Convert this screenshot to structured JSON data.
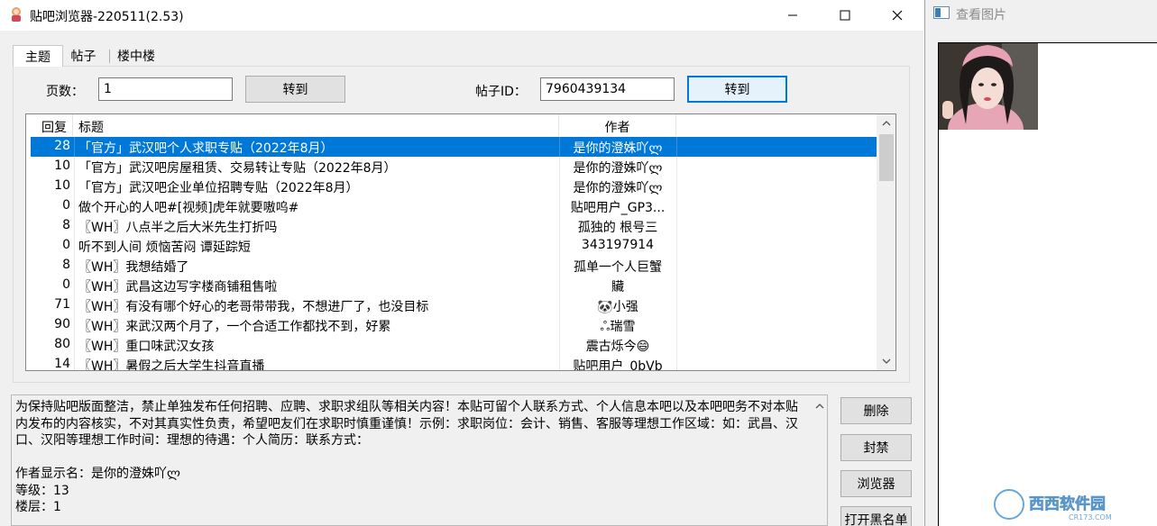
{
  "window": {
    "title": "贴吧浏览器-220511(2.53)"
  },
  "tabs": [
    {
      "label": "主题"
    },
    {
      "label": "帖子"
    },
    {
      "label": "楼中楼"
    }
  ],
  "page_label": "页数：",
  "page_value": "1",
  "goto_page_label": "转到",
  "post_id_label": "帖子ID：",
  "post_id_value": "7960439134",
  "goto_post_label": "转到",
  "list": {
    "headers": {
      "replies": "回复",
      "title": "标题",
      "author": "作者"
    },
    "rows": [
      {
        "replies": "28",
        "title": "「官方」武汉吧个人求职专贴（2022年8月）",
        "author": "是你的澄姝吖ლ",
        "selected": true
      },
      {
        "replies": "10",
        "title": "「官方」武汉吧房屋租赁、交易转让专贴（2022年8月）",
        "author": "是你的澄姝吖ლ"
      },
      {
        "replies": "10",
        "title": "「官方」武汉吧企业单位招聘专贴（2022年8月）",
        "author": "是你的澄姝吖ლ"
      },
      {
        "replies": "0",
        "title": "做个开心的人吧#[视频]虎年就要嗷呜#",
        "author": "贴吧用户_GP3..."
      },
      {
        "replies": "8",
        "title": "〖WH〗八点半之后大米先生打折吗",
        "author": "孤独的 根号三"
      },
      {
        "replies": "0",
        "title": "听不到人间 烦恼苦闷 谭延踪短",
        "author": "343197914"
      },
      {
        "replies": "8",
        "title": "〖WH〗我想结婚了",
        "author": "孤单一个人巨蟹"
      },
      {
        "replies": "0",
        "title": "〖WH〗武昌这边写字楼商铺租售啦",
        "author": "贜"
      },
      {
        "replies": "71",
        "title": "〖WH〗有没有哪个好心的老哥带带我，不想进厂了，也没目标",
        "author": "🐼小强"
      },
      {
        "replies": "90",
        "title": "〖WH〗来武汉两个月了，一个合适工作都找不到，好累",
        "author": "ஃ瑞雪"
      },
      {
        "replies": "80",
        "title": "〖WH〗重口味武汉女孩",
        "author": "震古烁今😄"
      },
      {
        "replies": "14",
        "title": "〖WH〗暑假之后大学生抖音直播",
        "author": "贴吧用户_0bVb"
      }
    ]
  },
  "detail": {
    "text": "为保持贴吧版面整洁，禁止单独发布任何招聘、应聘、求职求组队等相关内容！本贴可留个人联系方式、个人信息本吧以及本吧吧务不对本贴内发布的内容核实，不对其真实性负责，希望吧友们在求职时慎重谨慎！示例：求职岗位：会计、销售、客服等理想工作区域：如：武昌、汉口、汉阳等理想工作时间：理想的待遇：个人简历：联系方式：\n\n作者显示名：是你的澄姝吖ლ\n等级：13\n楼层：1"
  },
  "side_buttons": {
    "delete": "删除",
    "ban": "封禁",
    "browser": "浏览器",
    "blacklist": "打开黑名单"
  },
  "viewer": {
    "title": "查看图片"
  },
  "watermark_text": "西西软件园",
  "watermark_sub": "CR173.COM",
  "icons": {
    "app": "avatar-icon",
    "viewer": "picture-icon"
  },
  "colors": {
    "selection": "#0078d7",
    "accent_button_border": "#0078d7"
  }
}
